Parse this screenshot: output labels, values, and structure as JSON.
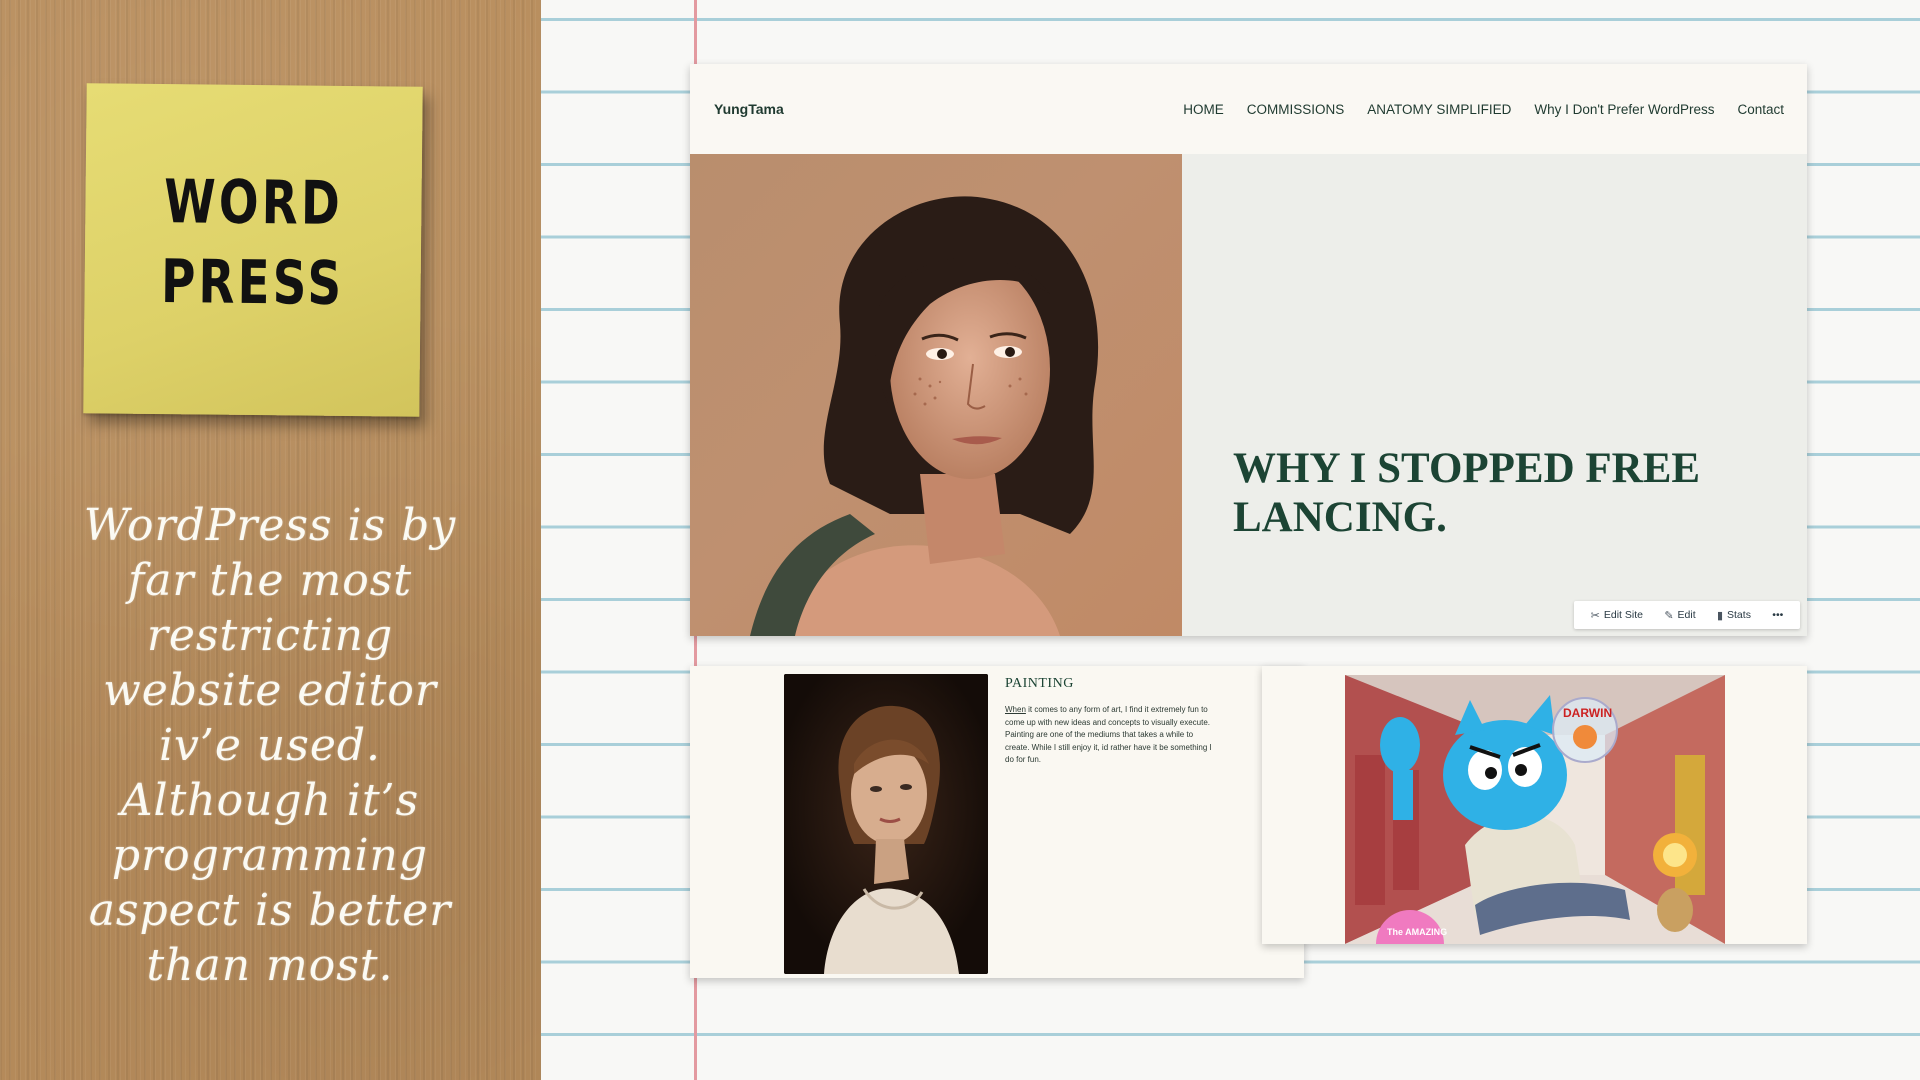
{
  "slide": {
    "sticky_note_line1": "WORD",
    "sticky_note_line2": "PRESS",
    "chalk_lines": [
      "WordPress is by",
      "far the most",
      "restricting",
      "website editor",
      "iv’e used.",
      "Although it’s",
      "programming",
      "aspect is better",
      "than most."
    ]
  },
  "site": {
    "brand": "YungTama",
    "nav": [
      "HOME",
      "COMMISSIONS",
      "ANATOMY SIMPLIFIED",
      "Why I Don't Prefer WordPress",
      "Contact"
    ],
    "hero_title": "WHY I STOPPED FREE LANCING.",
    "admin_bar": {
      "edit_site": "Edit Site",
      "edit": "Edit",
      "stats": "Stats",
      "more": "•••"
    }
  },
  "painting_card": {
    "title": "PAINTING",
    "body_lead": "When",
    "body": " it comes to any form of art, I find it extremely fun to come up with new ideas and concepts to visually execute. Painting are one of the mediums that takes a while to create. While I still enjoy it, id rather have it be something I do for fun."
  },
  "gumball_card": {
    "bubble_text": "DARWIN",
    "sticker_text": "The AMAZING"
  },
  "colors": {
    "cardboard": "#b88d5c",
    "sticky_note": "#e0d46a",
    "site_accent": "#1c4434",
    "margin_line": "#e39aa0",
    "ruled_line": "#a9cfd9"
  }
}
